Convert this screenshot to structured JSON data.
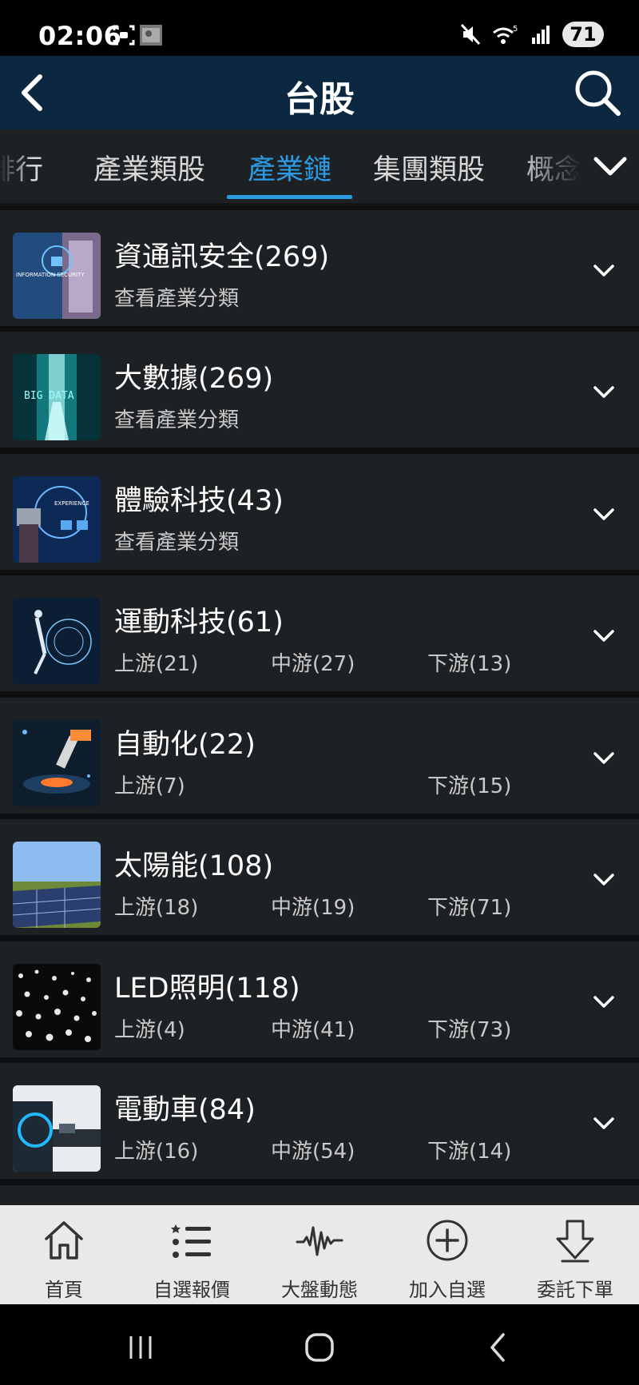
{
  "status_bar": {
    "time": "02:06",
    "battery": "71",
    "wifi_label": "5"
  },
  "header": {
    "title": "台股"
  },
  "tabs": [
    {
      "label": "排行",
      "active": false
    },
    {
      "label": "產業類股",
      "active": false
    },
    {
      "label": "產業鏈",
      "active": true
    },
    {
      "label": "集團類股",
      "active": false
    },
    {
      "label": "概念",
      "active": false
    }
  ],
  "industries": [
    {
      "title": "資通訊安全(269)",
      "type": "category",
      "sub": "查看產業分類",
      "thumb": "information-security"
    },
    {
      "title": "大數據(269)",
      "type": "category",
      "sub": "查看產業分類",
      "thumb": "big-data"
    },
    {
      "title": "體驗科技(43)",
      "type": "category",
      "sub": "查看產業分類",
      "thumb": "experience"
    },
    {
      "title": "運動科技(61)",
      "type": "chain",
      "upstream": "上游(21)",
      "midstream": "中游(27)",
      "downstream": "下游(13)",
      "thumb": "sport-tech"
    },
    {
      "title": "自動化(22)",
      "type": "chain",
      "upstream": "上游(7)",
      "midstream": "",
      "downstream": "下游(15)",
      "thumb": "robot-arm"
    },
    {
      "title": "太陽能(108)",
      "type": "chain",
      "upstream": "上游(18)",
      "midstream": "中游(19)",
      "downstream": "下游(71)",
      "thumb": "solar-panels"
    },
    {
      "title": "LED照明(118)",
      "type": "chain",
      "upstream": "上游(4)",
      "midstream": "中游(41)",
      "downstream": "下游(73)",
      "thumb": "led-lights"
    },
    {
      "title": "電動車(84)",
      "type": "chain",
      "upstream": "上游(16)",
      "midstream": "中游(54)",
      "downstream": "下游(14)",
      "thumb": "ev-charging"
    }
  ],
  "thumb_text": {
    "security": "INFORMATION SECURITY",
    "bigdata": "BIG DATA",
    "experience": "EXPERIENCE"
  },
  "bottom_nav": [
    {
      "label": "首頁",
      "icon": "home-icon"
    },
    {
      "label": "自選報價",
      "icon": "watchlist-icon"
    },
    {
      "label": "大盤動態",
      "icon": "pulse-icon"
    },
    {
      "label": "加入自選",
      "icon": "add-circle-icon"
    },
    {
      "label": "委託下單",
      "icon": "order-arrow-icon"
    }
  ],
  "colors": {
    "header_bg": "#0c2740",
    "accent": "#2b9ce4",
    "item_bg": "#1e2124",
    "nav_bg": "#e9e9e9"
  }
}
